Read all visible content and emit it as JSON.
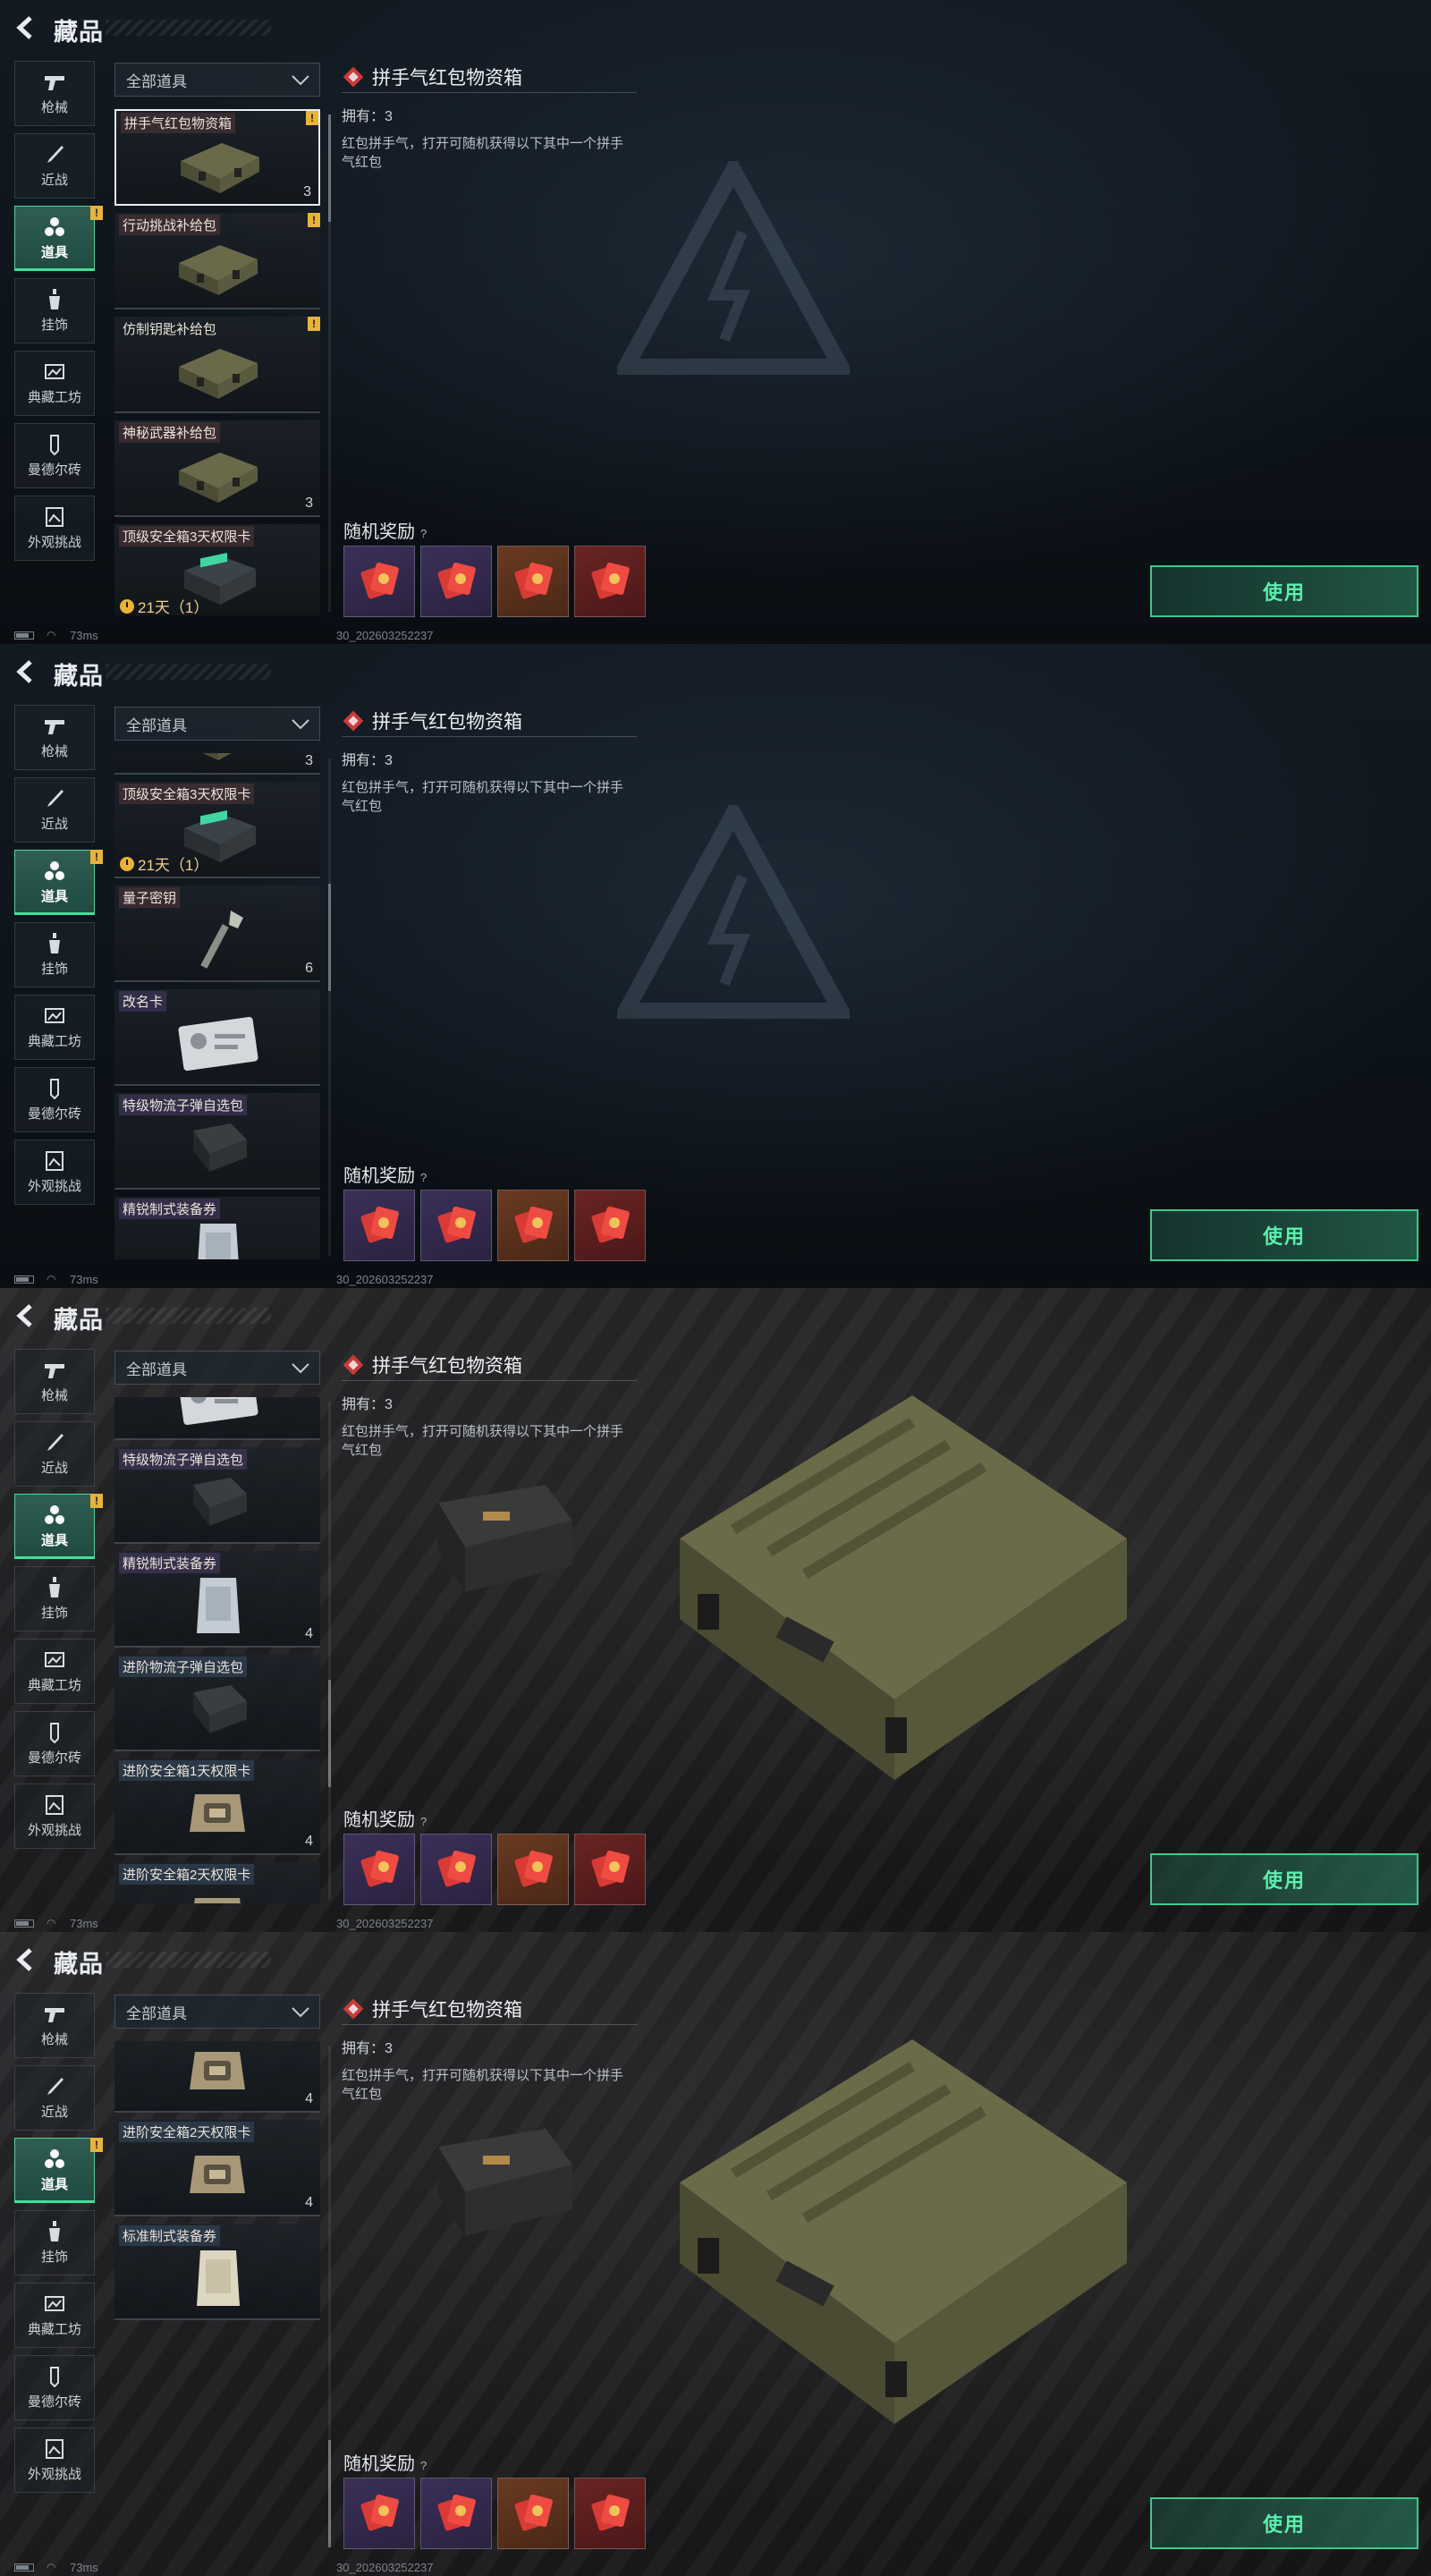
{
  "header": {
    "title": "藏品"
  },
  "filter": {
    "label": "全部道具"
  },
  "categories": [
    {
      "label": "枪械",
      "icon": "gun-icon"
    },
    {
      "label": "近战",
      "icon": "knife-icon"
    },
    {
      "label": "道具",
      "icon": "items-icon",
      "active": true,
      "badge": "!"
    },
    {
      "label": "挂饰",
      "icon": "charm-icon"
    },
    {
      "label": "典藏工坊",
      "icon": "workshop-icon"
    },
    {
      "label": "曼德尔砖",
      "icon": "brick-icon"
    },
    {
      "label": "外观挑战",
      "icon": "challenge-icon"
    }
  ],
  "items": [
    {
      "name": "拼手气红包物资箱",
      "qty": "3",
      "badge": "!",
      "thumb": "crate",
      "style": "red"
    },
    {
      "name": "行动挑战补给包",
      "badge": "!",
      "thumb": "crate",
      "style": "red"
    },
    {
      "name": "仿制钥匙补给包",
      "badge": "!",
      "thumb": "crate",
      "style": "plain"
    },
    {
      "name": "神秘武器补给包",
      "qty": "3",
      "thumb": "crate",
      "style": "red"
    },
    {
      "name": "顶级安全箱3天权限卡",
      "timer": "21天（1）",
      "thumb": "safe",
      "style": "red"
    },
    {
      "name": "量子密钥",
      "qty": "6",
      "thumb": "key",
      "style": "red"
    },
    {
      "name": "改名卡",
      "thumb": "card",
      "style": "violet"
    },
    {
      "name": "特级物流子弹自选包",
      "thumb": "ammo",
      "style": "violet"
    },
    {
      "name": "精锐制式装备券",
      "qty": "4",
      "thumb": "ticket",
      "style": "violet"
    },
    {
      "name": "进阶物流子弹自选包",
      "thumb": "ammo",
      "style": "blue"
    },
    {
      "name": "进阶安全箱1天权限卡",
      "qty": "4",
      "thumb": "safe2",
      "style": "blue"
    },
    {
      "name": "进阶安全箱2天权限卡",
      "qty": "4",
      "thumb": "safe2",
      "style": "blue"
    },
    {
      "name": "标准制式装备券",
      "thumb": "ticket2",
      "style": "blue"
    }
  ],
  "detail": {
    "title": "拼手气红包物资箱",
    "owned": "拥有：3",
    "description": "红包拼手气，打开可随机获得以下其中一个拼手气红包"
  },
  "rewards": {
    "title": "随机奖励",
    "help": "?",
    "tiles": [
      {
        "rarity": "purple",
        "icon": "red-envelope-icon"
      },
      {
        "rarity": "purple",
        "icon": "red-envelope-icon"
      },
      {
        "rarity": "orange",
        "icon": "red-envelope-icon"
      },
      {
        "rarity": "red",
        "icon": "red-envelope-icon"
      }
    ]
  },
  "use_button": {
    "label": "使用"
  },
  "status": {
    "ping": "73ms",
    "build": "30_20260325223​7"
  },
  "frames": [
    {
      "background": "dark"
    },
    {
      "background": "dark"
    },
    {
      "background": "photo"
    },
    {
      "background": "photo"
    }
  ]
}
